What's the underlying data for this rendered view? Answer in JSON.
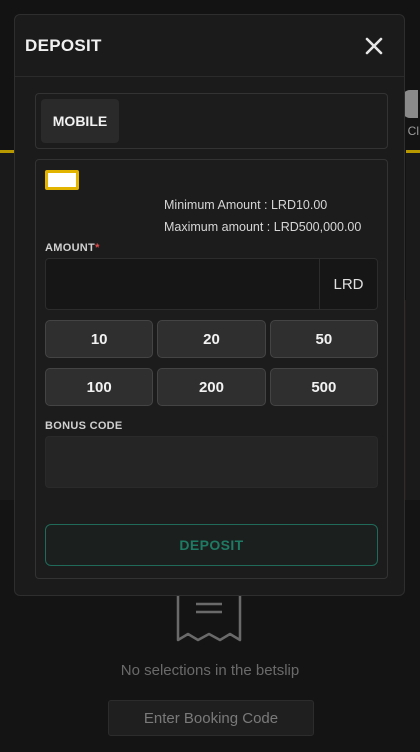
{
  "modal": {
    "title": "DEPOSIT",
    "method_tab": "MOBILE",
    "limits": {
      "minimum": "Minimum Amount : LRD10.00",
      "maximum": "Maximum amount : LRD500,000.00"
    },
    "amount": {
      "label": "AMOUNT",
      "required_mark": "*",
      "value": "",
      "currency": "LRD"
    },
    "quick_amounts": [
      "10",
      "20",
      "50",
      "100",
      "200",
      "500"
    ],
    "bonus": {
      "label": "BONUS CODE",
      "value": ""
    },
    "deposit_button": "DEPOSIT"
  },
  "background": {
    "betslip_empty": "No selections in the betslip",
    "booking_button": "Enter Booking Code",
    "right_label": "Cl"
  },
  "colors": {
    "accent_green": "#1f7a63",
    "accent_yellow": "#e2b400",
    "required_red": "#e04a4a"
  },
  "icons": {
    "close": "close-icon",
    "receipt": "receipt-icon"
  }
}
